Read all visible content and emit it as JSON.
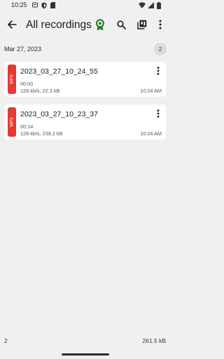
{
  "status_bar": {
    "time": "10:25"
  },
  "app_bar": {
    "title": "All recordings"
  },
  "group": {
    "date": "Mar 27, 2023",
    "count": "2"
  },
  "recordings": [
    {
      "format": "MP3",
      "name": "2023_03_27_10_24_55",
      "duration": "00:00",
      "details": "128 kb/s, 22.3 kB",
      "time": "10:24 AM"
    },
    {
      "format": "MP3",
      "name": "2023_03_27_10_23_37",
      "duration": "00:14",
      "details": "128 kb/s, 239.2 kB",
      "time": "10:24 AM"
    }
  ],
  "footer": {
    "count": "2",
    "total_size": "261.5 kB"
  },
  "colors": {
    "format_badge": "#e53935",
    "award_icon": "#2e7d32",
    "background": "#f0f0f0"
  },
  "icons": [
    "back-arrow-icon",
    "award-icon",
    "search-icon",
    "library-icon",
    "more-vertical-icon"
  ]
}
